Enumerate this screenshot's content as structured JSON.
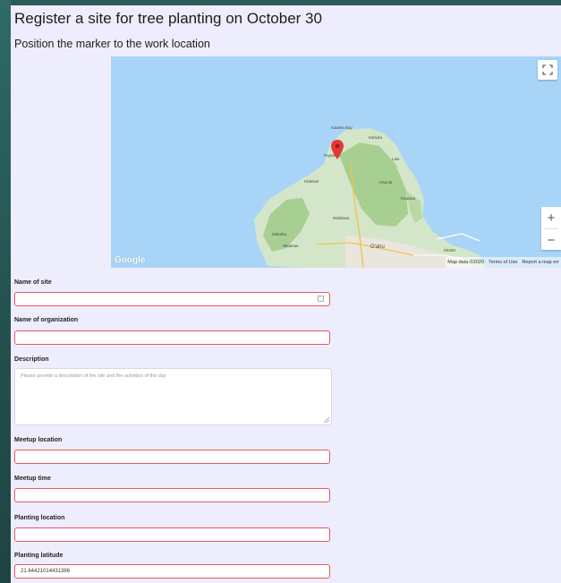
{
  "page": {
    "title": "Register a site for tree planting on October 30",
    "subtitle": "Position the marker to the work location"
  },
  "map": {
    "logo": "Google",
    "attribution": [
      "Map data ©2020",
      "Terms of Use",
      "Report a map err"
    ],
    "zoom_in": "+",
    "zoom_out": "−",
    "places": {
      "kawela_bay": "Kawela Bay",
      "kahuku": "Kahuku",
      "pupukea": "Pupukea",
      "laie": "Laie",
      "haleiwa": "Haleiwa",
      "hauula": "Hauula",
      "kaaawa": "Kaaawa",
      "wahiawa": "Wahiawa",
      "makaha": "Makaha",
      "waianae": "Waianae",
      "oahu": "O'ahu",
      "mcbh": "MCBH"
    },
    "icons": [
      "fullscreen-icon",
      "map-marker-icon"
    ]
  },
  "form": {
    "site_name_label": "Name of site",
    "organization_label": "Name of organization",
    "description_label": "Description",
    "description_placeholder": "Please provide a description of the site and the activities of the day",
    "meetup_location_label": "Meetup location",
    "meetup_time_label": "Meetup time",
    "planting_location_label": "Planting location",
    "planting_latitude_label": "Planting latitude",
    "planting_latitude_value": "21.64421014431386"
  },
  "colors": {
    "page_background": "#eeedfd",
    "frame": "#2b5f5c",
    "invalid_border": "#e05a61",
    "marker": "#e53935"
  }
}
